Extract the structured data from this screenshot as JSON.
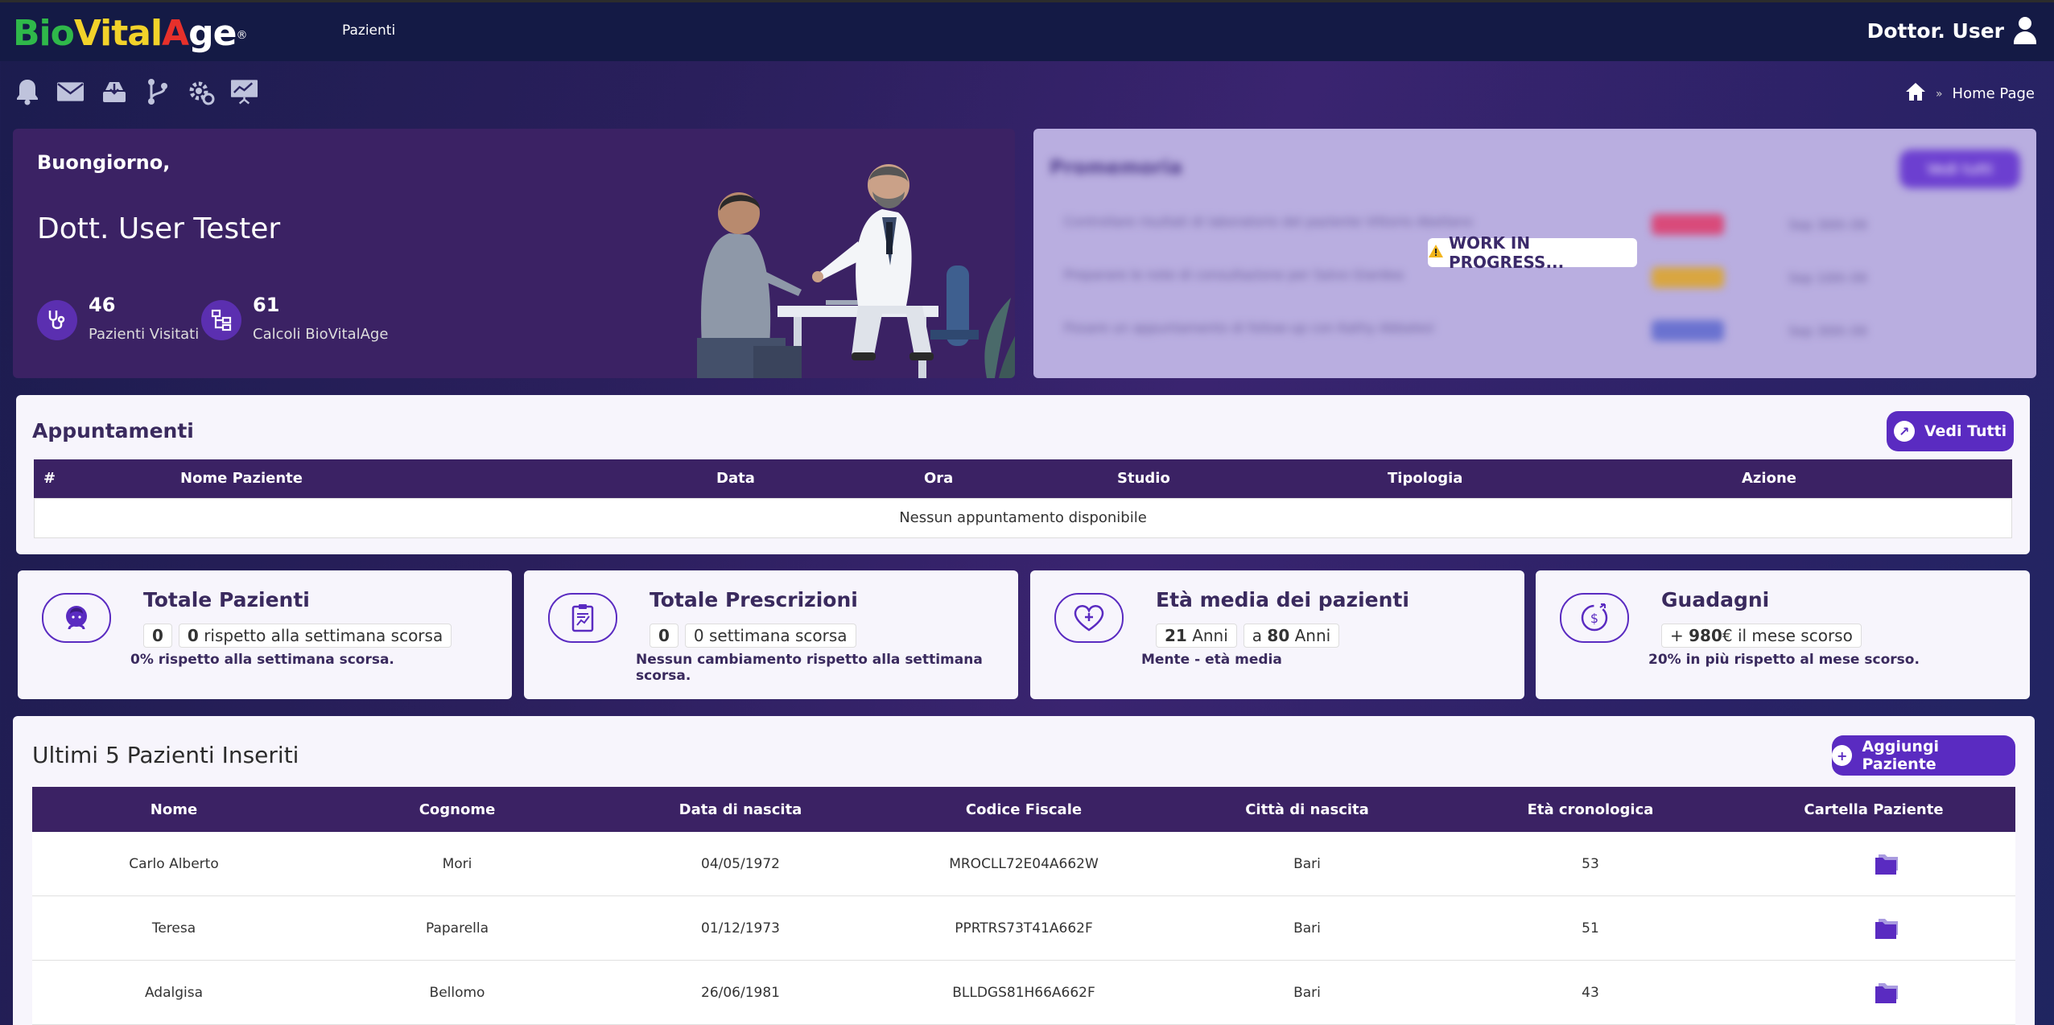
{
  "navbar": {
    "logo": {
      "b": "Bio",
      "v": "Vital",
      "a": "A",
      "rest": "ge",
      "reg": "®"
    },
    "nav_item": "Pazienti",
    "user_label": "Dottor. User"
  },
  "toolbar": {
    "icons": [
      "bell-icon",
      "mail-icon",
      "download-icon",
      "branch-icon",
      "gear-icon",
      "presentation-icon"
    ]
  },
  "breadcrumb": {
    "separator": "»",
    "current": "Home Page"
  },
  "welcome": {
    "greeting": "Buongiorno,",
    "doctor_name": "Dott. User Tester",
    "stats": [
      {
        "value": "46",
        "label": "Pazienti Visitati",
        "icon": "stethoscope-icon"
      },
      {
        "value": "61",
        "label": "Calcoli BioVitalAge",
        "icon": "hierarchy-icon"
      }
    ]
  },
  "promemoria": {
    "title": "Promemoria",
    "button": "Vedi tutti",
    "rows": [
      {
        "text": "Controllare risultati di laboratorio del paziente Vittorio Abellano",
        "date": "Sep 30th 09"
      },
      {
        "text": "Preparare le note di consultazione per Salvo Giardea",
        "date": "Sep 10th 09"
      },
      {
        "text": "Fissare un appuntamento di follow-up con Kathy Abbalesi",
        "date": "Sep 30th 09"
      }
    ],
    "overlay": "WORK IN PROGRESS..."
  },
  "appuntamenti": {
    "title": "Appuntamenti",
    "button": "Vedi Tutti",
    "columns": [
      "#",
      "Nome Paziente",
      "Data",
      "Ora",
      "Studio",
      "Tipologia",
      "Azione"
    ],
    "empty": "Nessun appuntamento disponibile"
  },
  "stat_cards": [
    {
      "title": "Totale Pazienti",
      "box1": "0",
      "box2_num": "0",
      "box2_text": " rispetto alla settimana scorsa",
      "desc": "0% rispetto alla settimana scorsa.",
      "icon": "patient-icon"
    },
    {
      "title": "Totale Prescrizioni",
      "box1": "0",
      "box2_num": "0",
      "box2_text": " settimana scorsa",
      "desc": "Nessun cambiamento rispetto alla settimana scorsa.",
      "icon": "clipboard-chart-icon"
    },
    {
      "title": "Età media dei pazienti",
      "box1_num": "21",
      "box1_text": " Anni",
      "box2_pre": "a ",
      "box2_num": "80",
      "box2_text": " Anni",
      "desc": "Mente - età media",
      "icon": "heart-plus-icon"
    },
    {
      "title": "Guadagni",
      "box1_pre": "+ ",
      "box1_num": "980",
      "box1_text": "€  il mese scorso",
      "desc": "20% in più rispetto al mese scorso.",
      "icon": "money-icon"
    }
  ],
  "patients": {
    "title": "Ultimi 5 Pazienti Inseriti",
    "button": "Aggiungi Paziente",
    "columns": [
      "Nome",
      "Cognome",
      "Data di nascita",
      "Codice Fiscale",
      "Città di nascita",
      "Età cronologica",
      "Cartella Paziente"
    ],
    "rows": [
      {
        "nome": "Carlo Alberto",
        "cognome": "Mori",
        "nascita": "04/05/1972",
        "cf": "MROCLL72E04A662W",
        "citta": "Bari",
        "eta": "53"
      },
      {
        "nome": "Teresa",
        "cognome": "Paparella",
        "nascita": "01/12/1973",
        "cf": "PPRTRS73T41A662F",
        "citta": "Bari",
        "eta": "51"
      },
      {
        "nome": "Adalgisa",
        "cognome": "Bellomo",
        "nascita": "26/06/1981",
        "cf": "BLLDGS81H66A662F",
        "citta": "Bari",
        "eta": "43"
      }
    ]
  },
  "colors": {
    "accent": "#5a2bc1",
    "dark_purple": "#3b2264",
    "navbar": "#141a45"
  }
}
